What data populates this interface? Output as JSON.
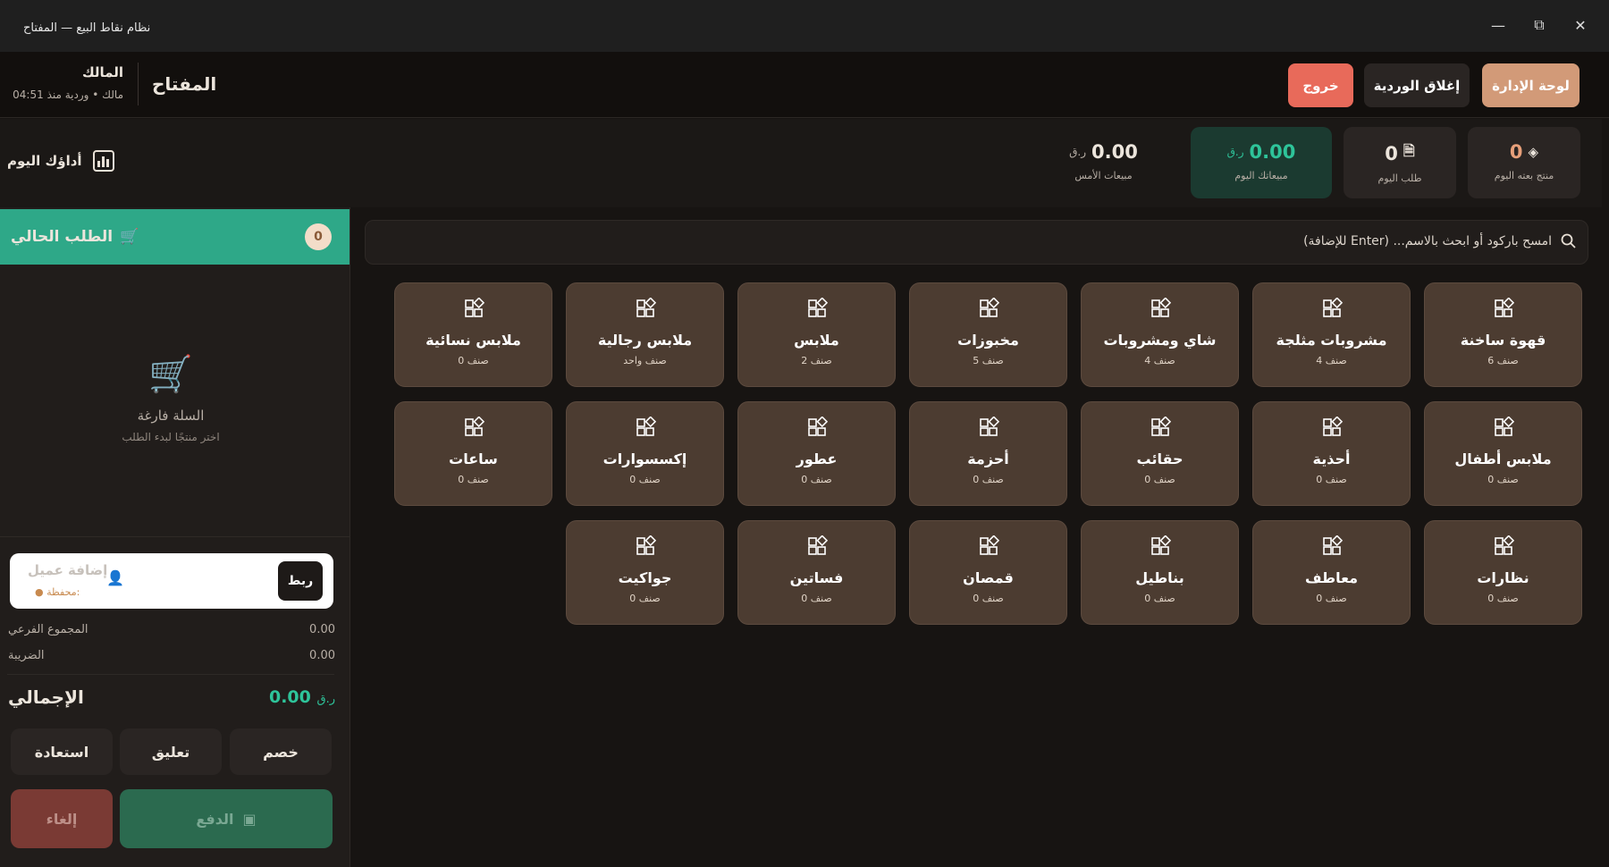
{
  "window": {
    "title": "نظام نقاط البيع — المفتاح"
  },
  "header": {
    "user_name": "المالك",
    "user_meta": "مالك • وردية منذ 04:51",
    "store_name": "المفتاح",
    "logout_label": "خروج",
    "close_shift_label": "إغلاق الوردية",
    "admin_label": "لوحة الإدارة",
    "colors": {
      "logout": "#e86a5a",
      "admin": "#d29a78"
    }
  },
  "stats": {
    "performance_label": "أداؤك اليوم",
    "yesterday": {
      "value": "0.00",
      "currency": "ر.ق",
      "label": "مبيعات الأمس"
    },
    "today_sales": {
      "value": "0.00",
      "currency": "ر.ق",
      "label": "مبيعاتك اليوم"
    },
    "orders": {
      "value": "0",
      "label": "طلب اليوم"
    },
    "products": {
      "value": "0",
      "label": "منتج بعته اليوم"
    }
  },
  "order": {
    "title": "الطلب الحالي",
    "count": "0",
    "empty_title": "السلة فارغة",
    "empty_hint": "اختر منتجًا لبدء الطلب",
    "customer_placeholder": "إضافة عميل",
    "wallet_label": "محفظة:",
    "link_label": "ربط",
    "subtotal_label": "المجموع الفرعي",
    "subtotal_value": "0.00",
    "tax_label": "الضريبة",
    "tax_value": "0.00",
    "total_label": "الإجمالي",
    "total_value": "0.00",
    "total_currency": "ر.ق",
    "discount_label": "خصم",
    "hold_label": "تعليق",
    "restore_label": "استعادة",
    "cancel_label": "إلغاء",
    "pay_label": "الدفع"
  },
  "search": {
    "placeholder": "امسح باركود أو ابحث بالاسم... (Enter للإضافة)"
  },
  "categories": [
    {
      "name": "قهوة ساخنة",
      "count": "6 صنف"
    },
    {
      "name": "مشروبات مثلجة",
      "count": "4 صنف"
    },
    {
      "name": "شاي ومشروبات",
      "count": "4 صنف"
    },
    {
      "name": "مخبوزات",
      "count": "5 صنف"
    },
    {
      "name": "ملابس",
      "count": "2 صنف"
    },
    {
      "name": "ملابس رجالية",
      "count": "صنف واحد"
    },
    {
      "name": "ملابس نسائية",
      "count": "0 صنف"
    },
    {
      "name": "ملابس أطفال",
      "count": "0 صنف"
    },
    {
      "name": "أحذية",
      "count": "0 صنف"
    },
    {
      "name": "حقائب",
      "count": "0 صنف"
    },
    {
      "name": "أحزمة",
      "count": "0 صنف"
    },
    {
      "name": "عطور",
      "count": "0 صنف"
    },
    {
      "name": "إكسسوارات",
      "count": "0 صنف"
    },
    {
      "name": "ساعات",
      "count": "0 صنف"
    },
    {
      "name": "نظارات",
      "count": "0 صنف"
    },
    {
      "name": "معاطف",
      "count": "0 صنف"
    },
    {
      "name": "بناطيل",
      "count": "0 صنف"
    },
    {
      "name": "قمصان",
      "count": "0 صنف"
    },
    {
      "name": "فساتين",
      "count": "0 صنف"
    },
    {
      "name": "جواكيت",
      "count": "0 صنف"
    }
  ]
}
